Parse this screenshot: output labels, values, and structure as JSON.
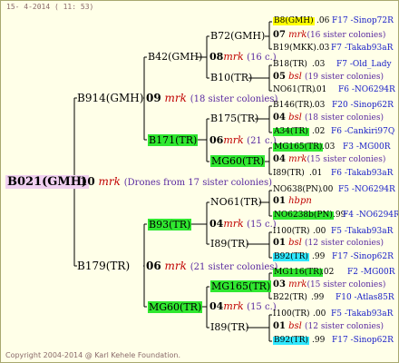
{
  "header": {
    "timestamp": "15- 4-2014 ( 11: 53)"
  },
  "footer": {
    "copyright": "Copyright 2004-2014 @ Karl Kehele Foundation."
  },
  "root": {
    "id": "B021(GMH)",
    "count": "10",
    "mrk": "mrk",
    "remark": "(Drones from 17 sister colonies)"
  },
  "g1": [
    {
      "id": "B914(GMH)",
      "count": "09",
      "mrk": "mrk",
      "remark": "(18 sister colonies)"
    },
    {
      "id": "B179(TR)",
      "count": "06",
      "mrk": "mrk",
      "remark": "(21 sister colonies)"
    }
  ],
  "g2": [
    {
      "id": "B42(GMH)",
      "count": "08",
      "mrk": "mrk",
      "remark": "(16 c.)"
    },
    {
      "id": "B171(TR)",
      "count": "06",
      "mrk": "mrk",
      "remark": "(21 c.)"
    },
    {
      "id": "B93(TR)",
      "count": "04",
      "mrk": "mrk",
      "remark": "(15 c.)"
    },
    {
      "id": "MG60(TR)",
      "count": "04",
      "mrk": "mrk",
      "remark": "(15 c.)"
    }
  ],
  "g3": [
    {
      "id": "B72(GMH)",
      "count": "07",
      "mrk": "mrk",
      "remark": "(16 sister colonies)"
    },
    {
      "id": "B10(TR)",
      "count": "05",
      "mrk": "bsl",
      "remark": "(19 sister colonies)"
    },
    {
      "id": "B175(TR)",
      "count": "04",
      "mrk": "bsl",
      "remark": "(18 sister colonies)"
    },
    {
      "id": "MG60(TR)",
      "count": "04",
      "mrk": "mrk",
      "remark": "(15 sister colonies)"
    },
    {
      "id": "NO61(TR)",
      "count": "01",
      "mrk": "hbpn",
      "remark": ""
    },
    {
      "id": "I89(TR)",
      "count": "01",
      "mrk": "bsl",
      "remark": "(12 sister colonies)"
    },
    {
      "id": "MG165(TR)",
      "count": "03",
      "mrk": "mrk",
      "remark": "(15 sister colonies)"
    },
    {
      "id": "I89(TR)",
      "count": "01",
      "mrk": "bsl",
      "remark": "(12 sister colonies)"
    }
  ],
  "g4": [
    {
      "id": "B8(GMH)",
      "val": ".06",
      "rank": "F17 -Sinop72R"
    },
    {
      "id": "B19(MKK)",
      "val": ".03",
      "rank": "F7 -Takab93aR"
    },
    {
      "id": "B18(TR)",
      "val": ".03",
      "rank": "F7 -Old_Lady"
    },
    {
      "id": "NO61(TR)",
      "val": ".01",
      "rank": "F6 -NO6294R"
    },
    {
      "id": "B146(TR)",
      "val": ".03",
      "rank": "F20 -Sinop62R"
    },
    {
      "id": "A34(TR)",
      "val": ".02",
      "rank": "F6 -Cankiri97Q"
    },
    {
      "id": "MG165(TR)",
      "val": ".03",
      "rank": "F3 -MG00R"
    },
    {
      "id": "I89(TR)",
      "val": ".01",
      "rank": "F6 -Takab93aR"
    },
    {
      "id": "NO638(PN)",
      "val": ".00",
      "rank": "F5 -NO6294R"
    },
    {
      "id": "NO6238b(PN)",
      "val": ".99",
      "rank": "F4 -NO6294R"
    },
    {
      "id": "I100(TR)",
      "val": ".00",
      "rank": "F5 -Takab93aR"
    },
    {
      "id": "B92(TR)",
      "val": ".99",
      "rank": "F17 -Sinop62R"
    },
    {
      "id": "MG116(TR)",
      "val": ".02",
      "rank": "F2 -MG00R"
    },
    {
      "id": "B22(TR)",
      "val": ".99",
      "rank": "F10 -Atlas85R"
    },
    {
      "id": "I100(TR)",
      "val": ".00",
      "rank": "F5 -Takab93aR"
    },
    {
      "id": "B92(TR)",
      "val": ".99",
      "rank": "F17 -Sinop62R"
    }
  ],
  "colors": {
    "highlight_green": "#30e830",
    "highlight_yellow": "#ffff00",
    "highlight_cyan": "#30e8ff",
    "highlight_pink": "#f0d0f0",
    "mrk_red": "#c00000",
    "remark_purple": "#5a2aa0",
    "rank_blue": "#1a20c8"
  }
}
